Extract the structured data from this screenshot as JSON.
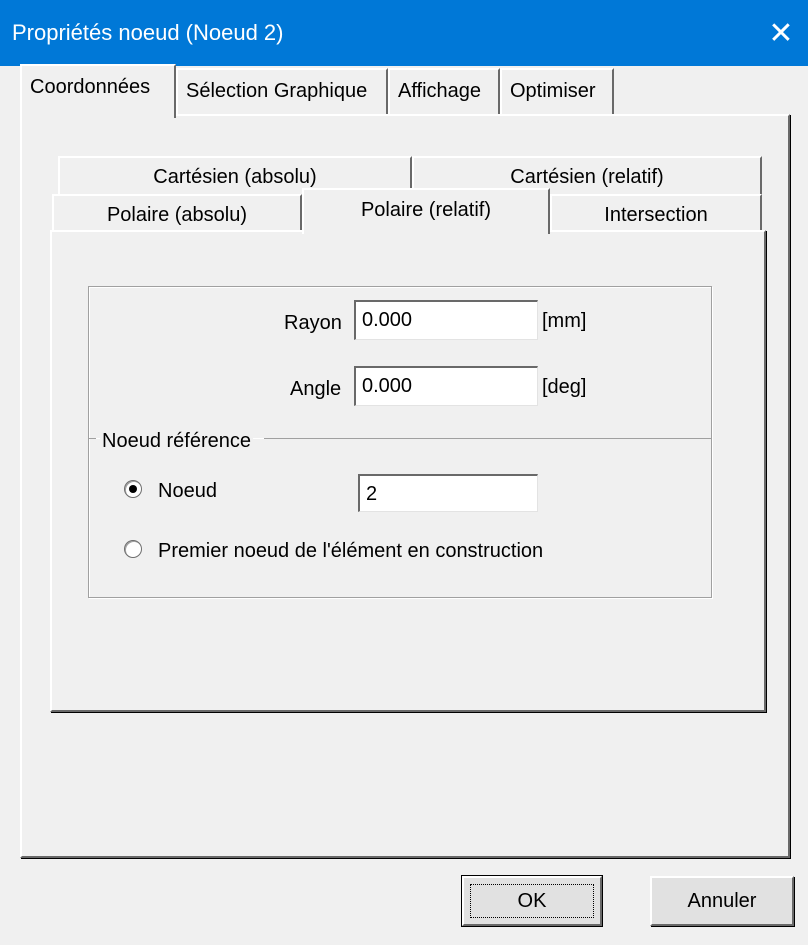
{
  "window": {
    "title": "Propriétés noeud (Noeud 2)",
    "close_symbol": "✕"
  },
  "outer_tabs": [
    {
      "label": "Coordonnées",
      "active": true
    },
    {
      "label": "Sélection Graphique",
      "active": false
    },
    {
      "label": "Affichage",
      "active": false
    },
    {
      "label": "Optimiser",
      "active": false
    }
  ],
  "inner_tabs": {
    "row_back": [
      {
        "label": "Cartésien (absolu)"
      },
      {
        "label": "Cartésien (relatif)"
      }
    ],
    "row_front": [
      {
        "label": "Polaire (absolu)",
        "active": false
      },
      {
        "label": "Polaire (relatif)",
        "active": true
      },
      {
        "label": "Intersection",
        "active": false
      }
    ]
  },
  "fields": {
    "rayon": {
      "label": "Rayon",
      "value": "0.000",
      "unit": "[mm]"
    },
    "angle": {
      "label": "Angle",
      "value": "0.000",
      "unit": "[deg]"
    }
  },
  "reference_group": {
    "title": "Noeud référence",
    "options": [
      {
        "label": "Noeud",
        "selected": true
      },
      {
        "label": "Premier noeud de l'élément en construction",
        "selected": false
      }
    ],
    "node_value": "2"
  },
  "buttons": {
    "ok": "OK",
    "cancel": "Annuler"
  },
  "colors": {
    "titlebar": "#0078d7",
    "face": "#f0f0f0"
  }
}
